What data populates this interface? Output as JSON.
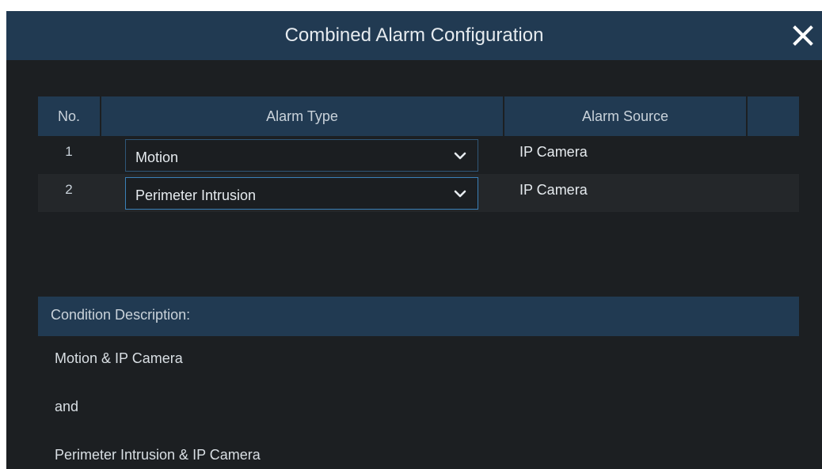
{
  "dialog": {
    "title": "Combined Alarm Configuration",
    "close_icon": "close-icon"
  },
  "table": {
    "headers": {
      "no": "No.",
      "alarm_type": "Alarm Type",
      "alarm_source": "Alarm Source",
      "extra": ""
    },
    "rows": [
      {
        "no": "1",
        "alarm_type": "Motion",
        "alarm_source": "IP Camera"
      },
      {
        "no": "2",
        "alarm_type": "Perimeter Intrusion",
        "alarm_source": "IP Camera"
      }
    ]
  },
  "condition": {
    "header": "Condition Description:",
    "lines": [
      "Motion & IP Camera",
      "and",
      "Perimeter Intrusion & IP Camera"
    ]
  },
  "colors": {
    "accent": "#213a52",
    "background": "#1c1f22",
    "select_focus_border": "#3a80b8"
  }
}
